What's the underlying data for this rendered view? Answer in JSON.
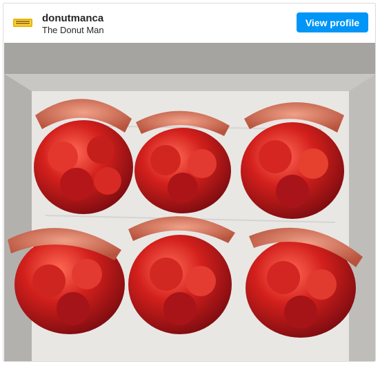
{
  "post": {
    "username": "donutmanca",
    "full_name": "The Donut Man",
    "view_profile_label": "View profile",
    "avatar_text": "DONUT MAN",
    "photo": {
      "description_icon": "photo",
      "subject": "strawberry donuts",
      "count": 6
    }
  },
  "colors": {
    "accent": "#0095f6",
    "strawberry": "#c81e1e",
    "dough": "#d9745f",
    "box": "#b9b7b3",
    "paper": "#ecebea"
  }
}
